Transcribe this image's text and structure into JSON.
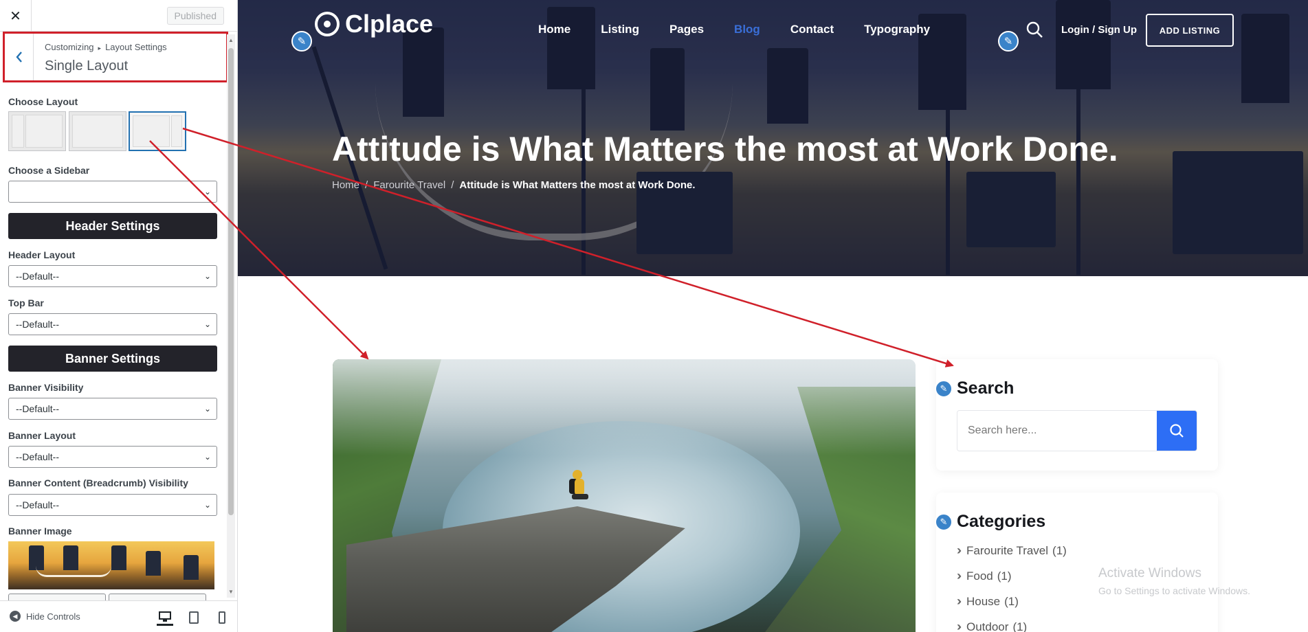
{
  "customizer": {
    "published_label": "Published",
    "breadcrumb_root": "Customizing",
    "breadcrumb_section": "Layout Settings",
    "title": "Single Layout",
    "choose_layout_label": "Choose Layout",
    "choose_sidebar_label": "Choose a Sidebar",
    "sidebar_value": "",
    "header_settings_label": "Header Settings",
    "header_layout_label": "Header Layout",
    "header_layout_value": "--Default--",
    "top_bar_label": "Top Bar",
    "top_bar_value": "--Default--",
    "banner_settings_label": "Banner Settings",
    "banner_visibility_label": "Banner Visibility",
    "banner_visibility_value": "--Default--",
    "banner_layout_label": "Banner Layout",
    "banner_layout_value": "--Default--",
    "banner_breadcrumb_label": "Banner Content (Breadcrumb) Visibility",
    "banner_breadcrumb_value": "--Default--",
    "banner_image_label": "Banner Image",
    "hide_controls_label": "Hide Controls"
  },
  "site": {
    "logo_text": "Clplace",
    "nav": [
      "Home",
      "Listing",
      "Pages",
      "Blog",
      "Contact",
      "Typography"
    ],
    "active_nav": "Blog",
    "login_label": "Login / Sign Up",
    "add_listing_label": "ADD LISTING",
    "hero_title": "Attitude is What Matters the most at Work Done.",
    "breadcrumb": {
      "home": "Home",
      "category": "Farourite Travel",
      "current": "Attitude is What Matters the most at Work Done."
    }
  },
  "sidebar_widgets": {
    "search_title": "Search",
    "search_placeholder": "Search here...",
    "categories_title": "Categories",
    "categories": [
      {
        "name": "Farourite Travel",
        "count": "(1)"
      },
      {
        "name": "Food",
        "count": "(1)"
      },
      {
        "name": "House",
        "count": "(1)"
      },
      {
        "name": "Outdoor",
        "count": "(1)"
      }
    ]
  },
  "windows_watermark": {
    "line1": "Activate Windows",
    "line2": "Go to Settings to activate Windows."
  },
  "colors": {
    "accent_blue": "#2d6ef5",
    "annotation_red": "#d0202a",
    "wp_blue": "#2271b1",
    "dark_button": "#23232a"
  }
}
